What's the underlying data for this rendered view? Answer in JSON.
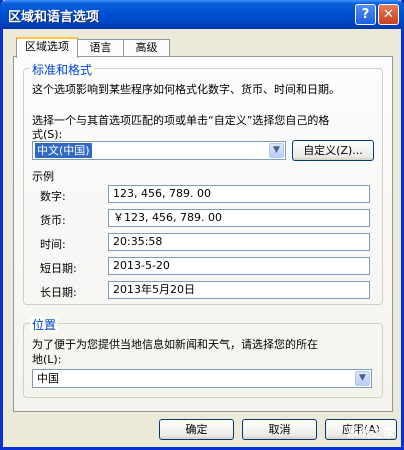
{
  "window": {
    "title": "区域和语言选项"
  },
  "tabs": [
    {
      "label": "区域选项",
      "active": true
    },
    {
      "label": "语言",
      "active": false
    },
    {
      "label": "高级",
      "active": false
    }
  ],
  "standards": {
    "legend": "标准和格式",
    "desc": "这个选项影响到某些程序如何格式化数字、货币、时间和日期。",
    "prompt_line1": "选择一个与其首选项匹配的项或单击“自定义”选择您自己的格",
    "prompt_line2": "式(S):",
    "selected_locale": "中文(中国)",
    "customize_label": "自定义(Z)..."
  },
  "samples": {
    "heading": "示例",
    "rows": [
      {
        "label": "数字:",
        "value": "123, 456, 789. 00"
      },
      {
        "label": "货币:",
        "value": "￥123, 456, 789. 00"
      },
      {
        "label": "时间:",
        "value": "20:35:58"
      },
      {
        "label": "短日期:",
        "value": "2013-5-20"
      },
      {
        "label": "长日期:",
        "value": "2013年5月20日"
      }
    ]
  },
  "location": {
    "legend": "位置",
    "desc_line1": "为了便于为您提供当地信息如新闻和天气，请选择您的所在",
    "desc_line2": "地(L):",
    "selected": "中国"
  },
  "footer": {
    "ok": "确定",
    "cancel": "取消",
    "apply": "应用(A)"
  },
  "watermark": "系统之家",
  "icons": {
    "help": "?",
    "close": "✕",
    "dropdown": "▼"
  }
}
